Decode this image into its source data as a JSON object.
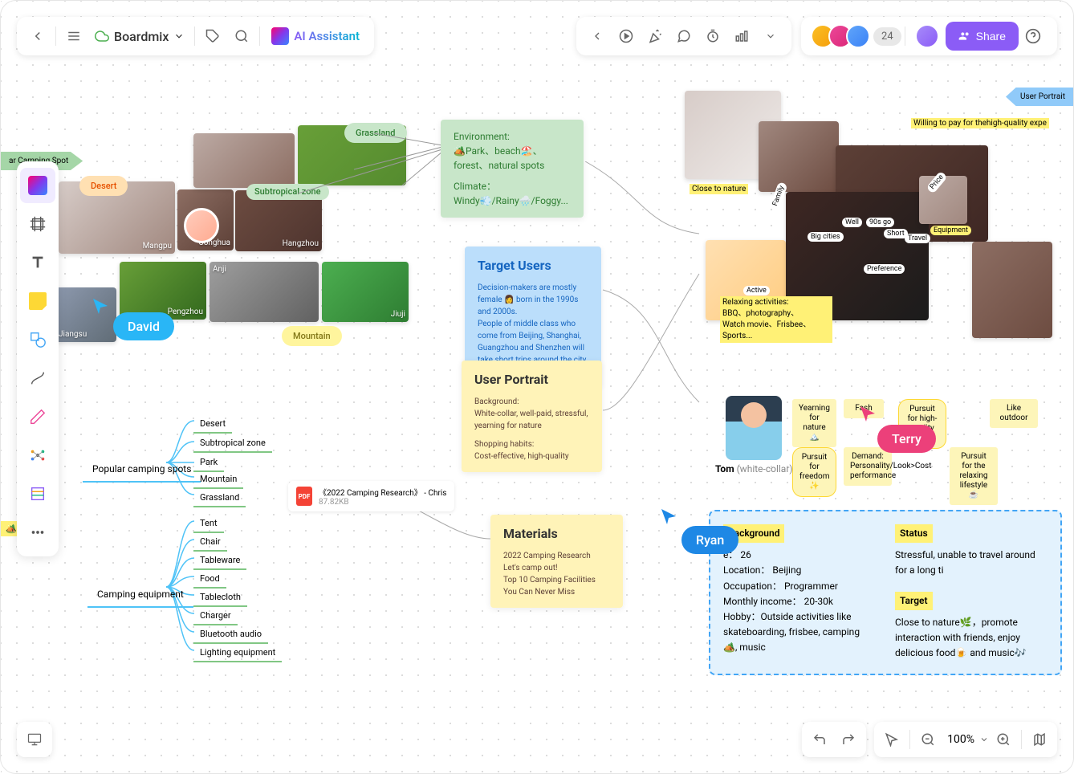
{
  "header": {
    "board_name": "Boardmix",
    "ai_assistant": "AI Assistant",
    "avatar_count": "24",
    "share": "Share"
  },
  "cursors": {
    "david": "David",
    "terry": "Terry",
    "ryan": "Ryan"
  },
  "pills": {
    "desert": "Desert",
    "grassland": "Grassland",
    "subtropical": "Subtropical zone",
    "mountain": "Mountain"
  },
  "corner_tags": {
    "camping_spot": "ar Camping Spot",
    "user_portrait": "User Portrait",
    "ca_tag": "🏕️Ca"
  },
  "image_labels": {
    "mangpu": "Mangpu",
    "conghua": "Conghua",
    "hangzhou": "Hangzhou",
    "jiangsu": "Jiangsu",
    "pengzhou": "Pengzhou",
    "anji": "Anji",
    "jiuji": "Jiuji"
  },
  "notes": {
    "env": {
      "l1": "Environment:",
      "l2": "🏕️Park、beach🏖️、forest、natural spots",
      "l3": "Climate：",
      "l4": "Windy💨/Rainy🌧️/Foggy..."
    },
    "target_users": {
      "title": "Target Users",
      "l1": "Decision-makers are mostly female 👩 born in the 1990s and 2000s.",
      "l2": "People of middle class who come from Beijing, Shanghai, Guangzhou and Shenzhen will take short trips around the city on weekends."
    },
    "user_portrait": {
      "title": "User Portrait",
      "l1": "Background:",
      "l2": "White-collar, well-paid, stressful, yearning for nature",
      "l3": "Shopping habits:",
      "l4": "Cost-effective, high-quality"
    },
    "materials": {
      "title": "Materials",
      "l1": "2022 Camping Research",
      "l2": "Let's camp out!",
      "l3": "Top 10 Camping Facilities You Can Never Miss"
    },
    "close_to_nature": "Close to nature",
    "willing_to_pay": "Willing to pay for thehigh-quality expe",
    "relaxing": {
      "l1": "Relaxing activities:",
      "l2": "BBQ、photography、",
      "l3": "Watch movie、Frisbee、Sports..."
    }
  },
  "mindmap": {
    "root1": "Popular camping spots",
    "root2": "Camping equipment",
    "leaves1": [
      "Desert",
      "Subtropical zone",
      "Park",
      "Mountain",
      "Grassland"
    ],
    "leaves2": [
      "Tent",
      "Chair",
      "Tableware",
      "Food",
      "Tablecloth",
      "Charger",
      "Bluetooth audio",
      "Lighting equipment"
    ]
  },
  "file": {
    "name": "《2022 Camping Research》 - Chris",
    "size": "87.82KB"
  },
  "persona": {
    "name": "Tom",
    "role": "(white-collar)"
  },
  "small_stickies": {
    "yearning": "Yearning for nature🏔️",
    "fash": "Fash",
    "pursuit_goods": "Pursuit for high-quality goods",
    "like_outdoor": "Like outdoor",
    "freedom": "Pursuit for freedom ✨",
    "demand": "Demand: Personality/Look>Cost performance",
    "relaxing": "Pursuit for the relaxing lifestyle☕"
  },
  "map_tags": {
    "family": "Family",
    "well": "Well",
    "x90s": "90s go",
    "big_cities": "Big cities",
    "short": "Short",
    "travel": "Travel",
    "equipment": "Equipment",
    "active": "Active",
    "preference": "Preference",
    "price": "Price"
  },
  "detail": {
    "background_h": "Background",
    "age": "e： 26",
    "location": "Location： Beijing",
    "occupation": "Occupation： Programmer",
    "income": "Monthly income： 20-30k",
    "hobby": "Hobby：Outside activities like skateboarding, frisbee, camping 🏕️, music",
    "status_h": "Status",
    "status": "Stressful, unable to travel around for a long ti",
    "target_h": "Target",
    "target": "Close to nature🌿，promote interaction with friends, enjoy delicious food🍺 and music🎶"
  },
  "zoom": "100%"
}
